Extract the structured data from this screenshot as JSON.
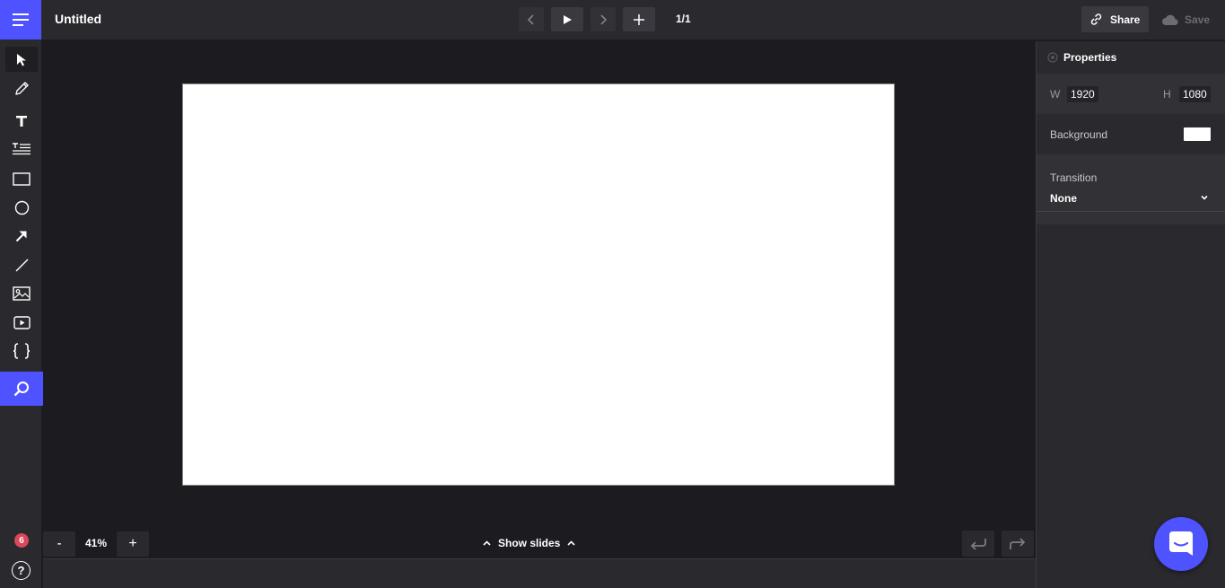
{
  "header": {
    "title": "Untitled",
    "page_count": "1/1",
    "share_label": "Share",
    "save_label": "Save"
  },
  "toolbar": {
    "tools": [
      "pointer-icon",
      "pencil-icon",
      "text-icon",
      "paragraph-icon",
      "rectangle-icon",
      "circle-icon",
      "arrow-icon",
      "line-icon",
      "image-icon",
      "video-icon",
      "code-braces-icon",
      "search-icon"
    ],
    "notification_count": "6",
    "help_label": "?"
  },
  "bottom": {
    "zoom_minus": "-",
    "zoom_level": "41%",
    "zoom_plus": "+",
    "show_slides_label": "Show slides"
  },
  "properties": {
    "title": "Properties",
    "width_label": "W",
    "width_value": "1920",
    "height_label": "H",
    "height_value": "1080",
    "background_label": "Background",
    "background_color": "#ffffff",
    "transition_label": "Transition",
    "transition_value": "None"
  },
  "colors": {
    "accent": "#4e52ff",
    "badge": "#d9475a",
    "panel": "#2a292e",
    "canvas_bg": "#1c1b20"
  }
}
